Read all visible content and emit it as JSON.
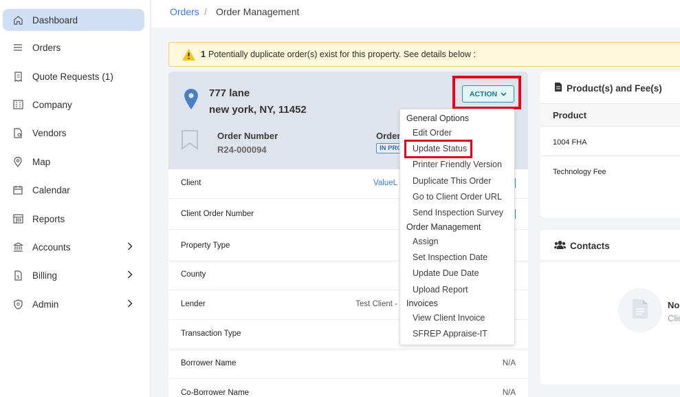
{
  "sidebar": {
    "items": [
      {
        "label": "Dashboard",
        "icon": "home-icon",
        "active": true
      },
      {
        "label": "Orders",
        "icon": "menu-lines-icon"
      },
      {
        "label": "Quote Requests (1)",
        "icon": "receipt-icon"
      },
      {
        "label": "Company",
        "icon": "building-icon"
      },
      {
        "label": "Vendors",
        "icon": "vendor-document-icon"
      },
      {
        "label": "Map",
        "icon": "map-pin-icon"
      },
      {
        "label": "Calendar",
        "icon": "calendar-icon"
      },
      {
        "label": "Reports",
        "icon": "reports-icon"
      },
      {
        "label": "Accounts",
        "icon": "bank-icon",
        "chevron": true
      },
      {
        "label": "Billing",
        "icon": "billing-icon",
        "chevron": true
      },
      {
        "label": "Admin",
        "icon": "shield-icon",
        "chevron": true
      }
    ]
  },
  "breadcrumb": {
    "parent": "Orders",
    "separator": "/",
    "current": "Order Management"
  },
  "alert": {
    "count": "1",
    "text": "Potentially duplicate order(s) exist for this property. See details below :"
  },
  "order": {
    "address_line1": "777 lane",
    "address_line2": "new york, NY, 11452",
    "order_number_label": "Order Number",
    "order_number": "R24-000094",
    "order_status_label": "Order",
    "status_badge": "IN PRO"
  },
  "details": [
    {
      "label": "Client",
      "value": "ValueL"
    },
    {
      "label": "Client Order Number",
      "value": ""
    },
    {
      "label": "Property Type",
      "value": ""
    },
    {
      "label": "County",
      "value": ""
    },
    {
      "label": "Lender",
      "value": "Test Client -"
    },
    {
      "label": "Transaction Type",
      "value": ""
    },
    {
      "label": "Borrower Name",
      "value": "N/A"
    },
    {
      "label": "Co-Borrower Name",
      "value": "N/A"
    }
  ],
  "action_button": {
    "label": "ACTION"
  },
  "dropdown": {
    "groups": [
      {
        "title": "General Options",
        "items": [
          "Edit Order",
          "Update Status",
          "Printer Friendly Version",
          "Duplicate This Order",
          "Go to Client Order URL",
          "Send Inspection Survey"
        ]
      },
      {
        "title": "Order Management",
        "items": [
          "Assign",
          "Set Inspection Date",
          "Update Due Date",
          "Upload Report"
        ]
      },
      {
        "title": "Invoices",
        "items": [
          "View Client Invoice",
          "SFREP Appraise-IT"
        ]
      }
    ]
  },
  "products_panel": {
    "title": "Product(s) and Fee(s)",
    "column": "Product",
    "rows": [
      "1004 FHA",
      "Technology Fee"
    ]
  },
  "contacts_panel": {
    "title": "Contacts",
    "empty_line1": "No",
    "empty_line2": "Clic"
  },
  "colors": {
    "accent_teal": "#1f9aa6",
    "link_blue": "#3b7ccc",
    "highlight_red": "#e3001b",
    "warning_yellow": "#f5c518"
  }
}
